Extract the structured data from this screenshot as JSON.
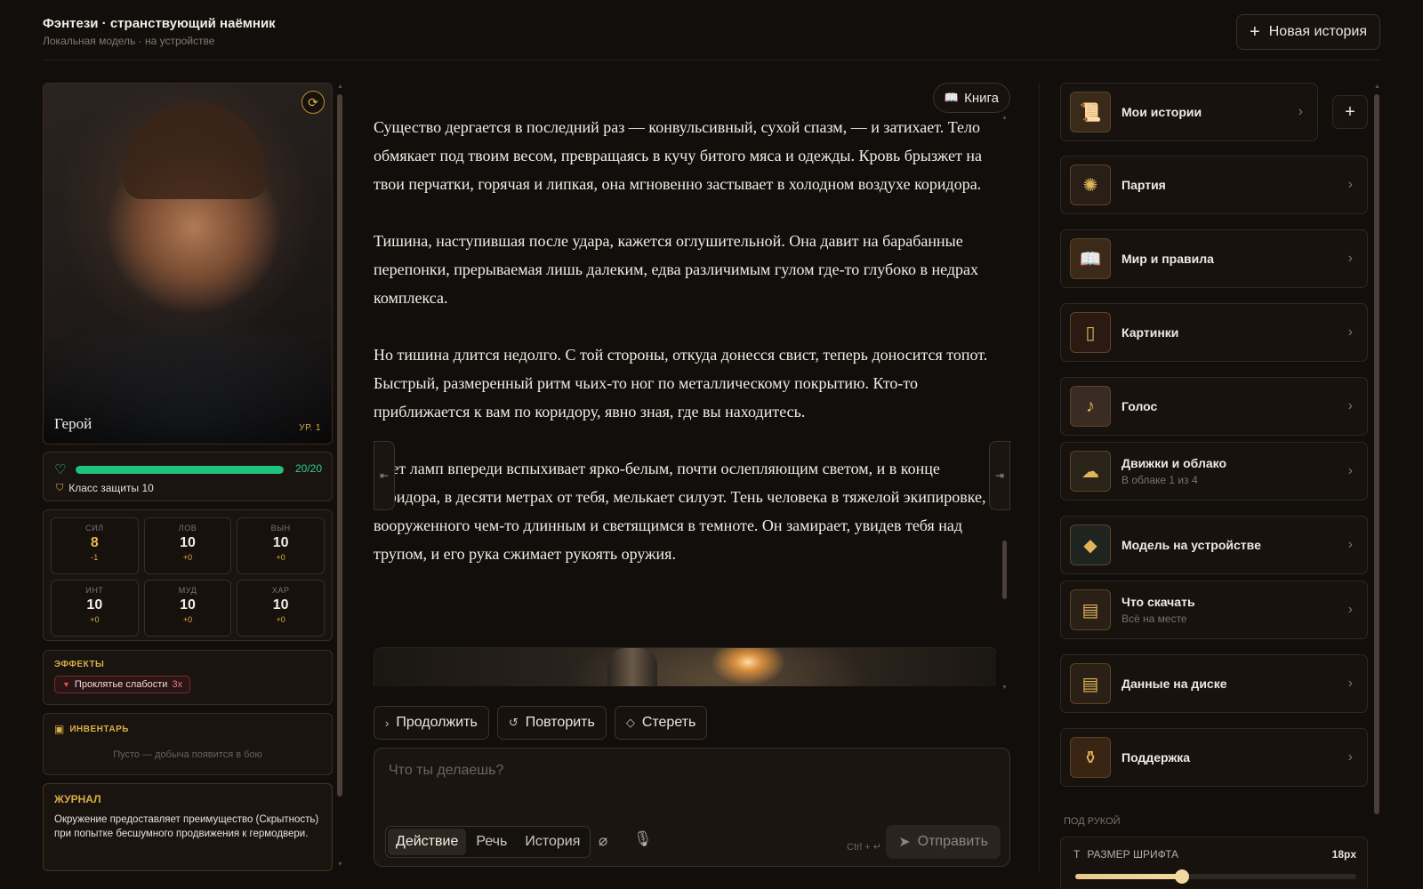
{
  "header": {
    "title": "Фэнтези · странствующий наёмник",
    "subtitle": "Локальная модель · на устройстве",
    "new_story_label": "Новая история"
  },
  "hero": {
    "name": "Герой",
    "level": "УР. 1",
    "hp_text": "20/20",
    "hp_fraction": 1.0,
    "armor_class": "Класс защиты 10"
  },
  "stats": [
    {
      "label": "СИЛ",
      "value": "8",
      "mod": "-1",
      "low": true
    },
    {
      "label": "ЛОВ",
      "value": "10",
      "mod": "+0",
      "low": false
    },
    {
      "label": "ВЫН",
      "value": "10",
      "mod": "+0",
      "low": false
    },
    {
      "label": "ИНТ",
      "value": "10",
      "mod": "+0",
      "low": false
    },
    {
      "label": "МУД",
      "value": "10",
      "mod": "+0",
      "low": false
    },
    {
      "label": "ХАР",
      "value": "10",
      "mod": "+0",
      "low": false
    }
  ],
  "effects": {
    "label": "ЭФФЕКТЫ",
    "items": [
      {
        "name": "Проклятье слабости",
        "stack": "3x"
      }
    ]
  },
  "inventory": {
    "label": "ИНВЕНТАРЬ",
    "empty_text": "Пусто — добыча появится в бою"
  },
  "journal": {
    "label": "ЖУРНАЛ",
    "text": "Окружение предоставляет преимущество (Скрытность) при попытке бесшумного продвижения к гермодвери."
  },
  "story": {
    "book_label": "Книга",
    "paragraphs": [
      "Существо дергается в последний раз — конвульсивный, сухой спазм, — и затихает. Тело обмякает под твоим весом, превращаясь в кучу битого мяса и одежды. Кровь брызжет на твои перчатки, горячая и липкая, она мгновенно застывает в холодном воздухе коридора.",
      "Тишина, наступившая после удара, кажется оглушительной. Она давит на барабанные перепонки, прерываемая лишь далеким, едва различимым гулом где-то глубоко в недрах комплекса.",
      "Но тишина длится недолго. С той стороны, откуда донесся свист, теперь доносится топот. Быстрый, размеренный ритм чьих-то ног по металлическому покрытию. Кто-то приближается к вам по коридору, явно зная, где вы находитесь.",
      "Свет ламп впереди вспыхивает ярко-белым, почти ослепляющим светом, и в конце коридора, в десяти метрах от тебя, мелькает силуэт. Тень человека в тяжелой экипировке, вооруженного чем-то длинным и светящимся в темноте. Он замирает, увидев тебя над трупом, и его рука сжимает рукоять оружия."
    ]
  },
  "actions": {
    "continue": "Продолжить",
    "retry": "Повторить",
    "erase": "Стереть"
  },
  "composer": {
    "placeholder": "Что ты делаешь?",
    "modes": [
      "Действие",
      "Речь",
      "История"
    ],
    "active_mode": "Действие",
    "hint": "Ctrl + ↵",
    "send_label": "Отправить"
  },
  "nav": [
    {
      "label": "Мои истории",
      "sub": "",
      "icon": "scroll-icon"
    },
    {
      "label": "Партия",
      "sub": "",
      "icon": "emblem-icon"
    },
    {
      "label": "Мир и правила",
      "sub": "",
      "icon": "book-icon"
    },
    {
      "label": "Картинки",
      "sub": "",
      "icon": "frame-icon"
    },
    {
      "label": "Голос",
      "sub": "",
      "icon": "voice-icon"
    },
    {
      "label": "Движки и облако",
      "sub": "В облаке 1 из 4",
      "icon": "cloud-icon"
    },
    {
      "label": "Модель на устройстве",
      "sub": "",
      "icon": "gem-icon"
    },
    {
      "label": "Что скачать",
      "sub": "Всё на месте",
      "icon": "chest-icon"
    },
    {
      "label": "Данные на диске",
      "sub": "",
      "icon": "chest-icon"
    },
    {
      "label": "Поддержка",
      "sub": "",
      "icon": "potion-icon"
    }
  ],
  "under_hand_label": "ПОД РУКОЙ",
  "font_size": {
    "label": "РАЗМЕР ШРИФТА",
    "value": "18px",
    "fraction": 0.38
  },
  "colors": {
    "accent": "#d8ad45",
    "hp": "#1ec27c",
    "background": "#120e0b"
  }
}
